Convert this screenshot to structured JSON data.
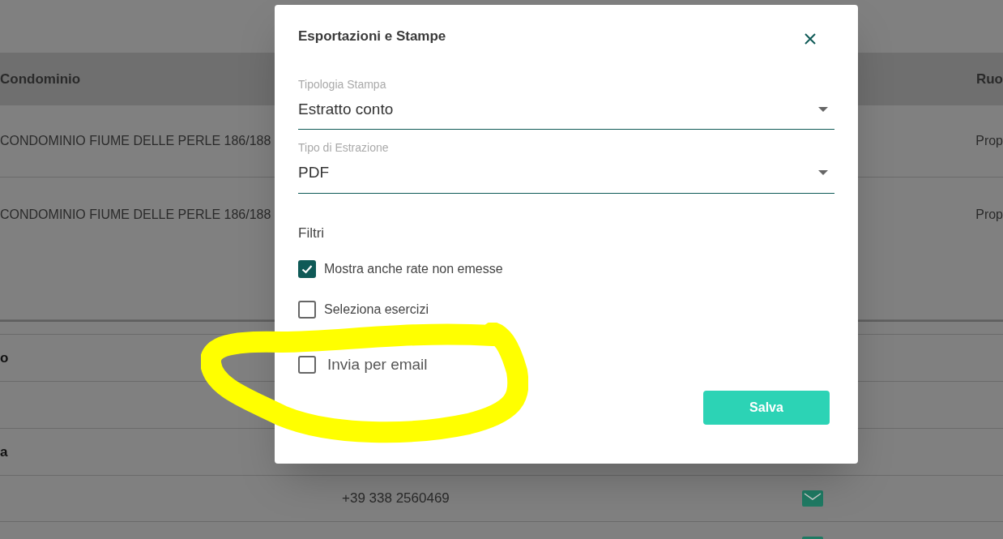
{
  "table": {
    "columns": [
      "Condominio",
      "Ruo"
    ],
    "rows": [
      {
        "cells": [
          "CONDOMINIO FIUME DELLE PERLE 186/188",
          "Prop"
        ]
      },
      {
        "cells": [
          "CONDOMINIO FIUME DELLE PERLE 186/188",
          "Prop"
        ]
      }
    ]
  },
  "contacts": [
    {
      "kind": "heading",
      "label": "o"
    },
    {
      "kind": "empty"
    },
    {
      "kind": "heading",
      "label": "a"
    },
    {
      "kind": "contact",
      "phone": "+39 338 2560469"
    },
    {
      "kind": "contact"
    }
  ],
  "dialog": {
    "title": "Esportazioni e Stampe",
    "fields": [
      {
        "label": "Tipologia Stampa",
        "value": "Estratto conto"
      },
      {
        "label": "Tipo di Estrazione",
        "value": "PDF"
      }
    ],
    "filters_title": "Filtri",
    "options": [
      {
        "kind": "normal",
        "label": "Mostra anche rate non emesse",
        "checked": true
      },
      {
        "kind": "normal",
        "label": "Seleziona esercizi",
        "checked": false
      },
      {
        "kind": "large",
        "label": "Invia per email",
        "checked": false
      }
    ],
    "save_button": "Salva"
  }
}
